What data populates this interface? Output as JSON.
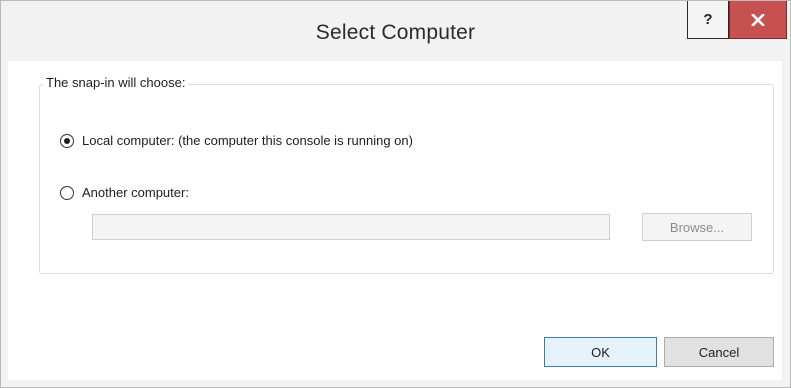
{
  "window": {
    "title": "Select Computer",
    "help_label": "?"
  },
  "group": {
    "label": "The snap-in will choose:"
  },
  "options": [
    {
      "label": "Local computer: (the computer this console is running on)",
      "selected": true
    },
    {
      "label": "Another computer:",
      "selected": false
    }
  ],
  "computer_input": {
    "value": ""
  },
  "buttons": {
    "browse": "Browse...",
    "ok": "OK",
    "cancel": "Cancel"
  },
  "colors": {
    "close_button": "#c75050",
    "ok_border": "#3c7fb1",
    "ok_fill": "#e5f1fb"
  },
  "icons": {
    "help": "help-icon",
    "close": "close-icon"
  }
}
